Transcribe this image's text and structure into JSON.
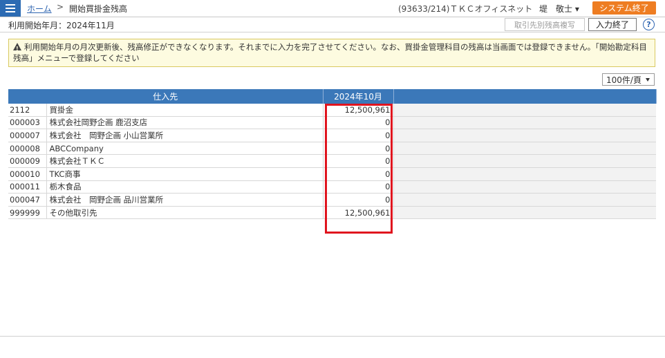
{
  "header": {
    "home_link": "ホーム",
    "separator": ">",
    "current_page": "開始買掛金残高",
    "office_info": "(93633/214)ＴＫＣオフィスネット",
    "user_name": "堤　敬士 ▾",
    "system_end_label": "システム終了"
  },
  "subbar": {
    "start_month": "利用開始年月：2024年11月",
    "copy_button_label": "取引先別残高複写",
    "input_end_label": "入力終了",
    "help_label": "?"
  },
  "notice": {
    "text": "利用開始年月の月次更新後、残高修正ができなくなります。それまでに入力を完了させてください。なお、買掛金管理科目の残高は当画面では登録できません。「開始勘定科目残高」メニューで登録してください"
  },
  "pagination": {
    "per_page": "100件/頁"
  },
  "table": {
    "headers": [
      "仕入先",
      "2024年10月"
    ],
    "rows": [
      {
        "code": "2112",
        "name": "買掛金",
        "amount": "12,500,961"
      },
      {
        "code": "000003",
        "name": "株式会社岡野企画 鹿沼支店",
        "amount": "0"
      },
      {
        "code": "000007",
        "name": "株式会社　岡野企画 小山営業所",
        "amount": "0"
      },
      {
        "code": "000008",
        "name": "ABCCompany",
        "amount": "0"
      },
      {
        "code": "000009",
        "name": "株式会社ＴＫＣ",
        "amount": "0"
      },
      {
        "code": "000010",
        "name": "TKC商事",
        "amount": "0"
      },
      {
        "code": "000011",
        "name": "栃木食品",
        "amount": "0"
      },
      {
        "code": "000047",
        "name": "株式会社　岡野企画 品川営業所",
        "amount": "0"
      },
      {
        "code": "999999",
        "name": "その他取引先",
        "amount": "12,500,961"
      }
    ]
  },
  "colors": {
    "header_blue": "#3b78b9",
    "menu_blue": "#2c6bb3",
    "system_end_orange": "#ee7d22",
    "highlight_red": "#e0141e",
    "notice_bg": "#fdfbe0"
  }
}
